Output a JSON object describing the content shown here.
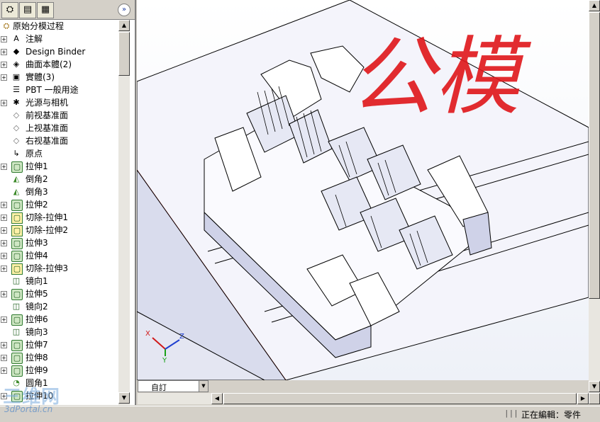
{
  "tree": {
    "tabs": [
      {
        "name": "feature-manager",
        "glyph": "⛭"
      },
      {
        "name": "property-manager",
        "glyph": "▤"
      },
      {
        "name": "configuration-manager",
        "glyph": "▦"
      }
    ],
    "expand_glyph": "»",
    "root_label": "原始分模过程",
    "items": [
      {
        "label": "注解",
        "icon": "annotation-icon",
        "glyph": "A",
        "expandable": true
      },
      {
        "label": "Design Binder",
        "icon": "design-binder-icon",
        "glyph": "◆",
        "expandable": true
      },
      {
        "label": "曲面本體(2)",
        "icon": "surface-bodies-icon",
        "glyph": "◈",
        "expandable": true
      },
      {
        "label": "實體(3)",
        "icon": "solid-bodies-icon",
        "glyph": "▣",
        "expandable": true
      },
      {
        "label": "PBT 一般用途",
        "icon": "material-icon",
        "glyph": "☰",
        "expandable": false
      },
      {
        "label": "光源与相机",
        "icon": "lights-cameras-icon",
        "glyph": "✱",
        "expandable": true
      },
      {
        "label": "前视基准面",
        "icon": "plane-icon",
        "glyph": "◇",
        "expandable": false
      },
      {
        "label": "上视基准面",
        "icon": "plane-icon",
        "glyph": "◇",
        "expandable": false
      },
      {
        "label": "右视基准面",
        "icon": "plane-icon",
        "glyph": "◇",
        "expandable": false
      },
      {
        "label": "原点",
        "icon": "origin-icon",
        "glyph": "↳",
        "expandable": false
      },
      {
        "label": "拉伸1",
        "icon": "extrude-icon",
        "glyph": "▢",
        "expandable": true
      },
      {
        "label": "倒角2",
        "icon": "chamfer-icon",
        "glyph": "◭",
        "expandable": false
      },
      {
        "label": "倒角3",
        "icon": "chamfer-icon",
        "glyph": "◭",
        "expandable": false
      },
      {
        "label": "拉伸2",
        "icon": "extrude-icon",
        "glyph": "▢",
        "expandable": true
      },
      {
        "label": "切除-拉伸1",
        "icon": "cut-extrude-icon",
        "glyph": "▢",
        "expandable": true
      },
      {
        "label": "切除-拉伸2",
        "icon": "cut-extrude-icon",
        "glyph": "▢",
        "expandable": true
      },
      {
        "label": "拉伸3",
        "icon": "extrude-icon",
        "glyph": "▢",
        "expandable": true
      },
      {
        "label": "拉伸4",
        "icon": "extrude-icon",
        "glyph": "▢",
        "expandable": true
      },
      {
        "label": "切除-拉伸3",
        "icon": "cut-extrude-icon",
        "glyph": "▢",
        "expandable": true
      },
      {
        "label": "镜向1",
        "icon": "mirror-icon",
        "glyph": "◫",
        "expandable": false
      },
      {
        "label": "拉伸5",
        "icon": "extrude-icon",
        "glyph": "▢",
        "expandable": true
      },
      {
        "label": "镜向2",
        "icon": "mirror-icon",
        "glyph": "◫",
        "expandable": false
      },
      {
        "label": "拉伸6",
        "icon": "extrude-icon",
        "glyph": "▢",
        "expandable": true
      },
      {
        "label": "镜向3",
        "icon": "mirror-icon",
        "glyph": "◫",
        "expandable": false
      },
      {
        "label": "拉伸7",
        "icon": "extrude-icon",
        "glyph": "▢",
        "expandable": true
      },
      {
        "label": "拉伸8",
        "icon": "extrude-icon",
        "glyph": "▢",
        "expandable": true
      },
      {
        "label": "拉伸9",
        "icon": "extrude-icon",
        "glyph": "▢",
        "expandable": true
      },
      {
        "label": "圆角1",
        "icon": "fillet-icon",
        "glyph": "◔",
        "expandable": false
      },
      {
        "label": "拉伸10",
        "icon": "extrude-icon",
        "glyph": "▢",
        "expandable": true
      }
    ]
  },
  "viewport": {
    "handwriting": "公模",
    "handwriting_color": "#e0161a",
    "triad": {
      "x": "X",
      "y": "Y",
      "z": "Z"
    },
    "triad_colors": {
      "x": "#d01818",
      "y": "#18a018",
      "z": "#2040d0"
    }
  },
  "config": {
    "label": "自訂"
  },
  "status": {
    "grip": "|||",
    "text": "正在編輯：零件"
  },
  "watermark": {
    "logo": "三维网",
    "site": "3dPortal.cn"
  },
  "scroll_arrows": {
    "up": "▲",
    "down": "▼",
    "left": "◀",
    "right": "▶"
  }
}
